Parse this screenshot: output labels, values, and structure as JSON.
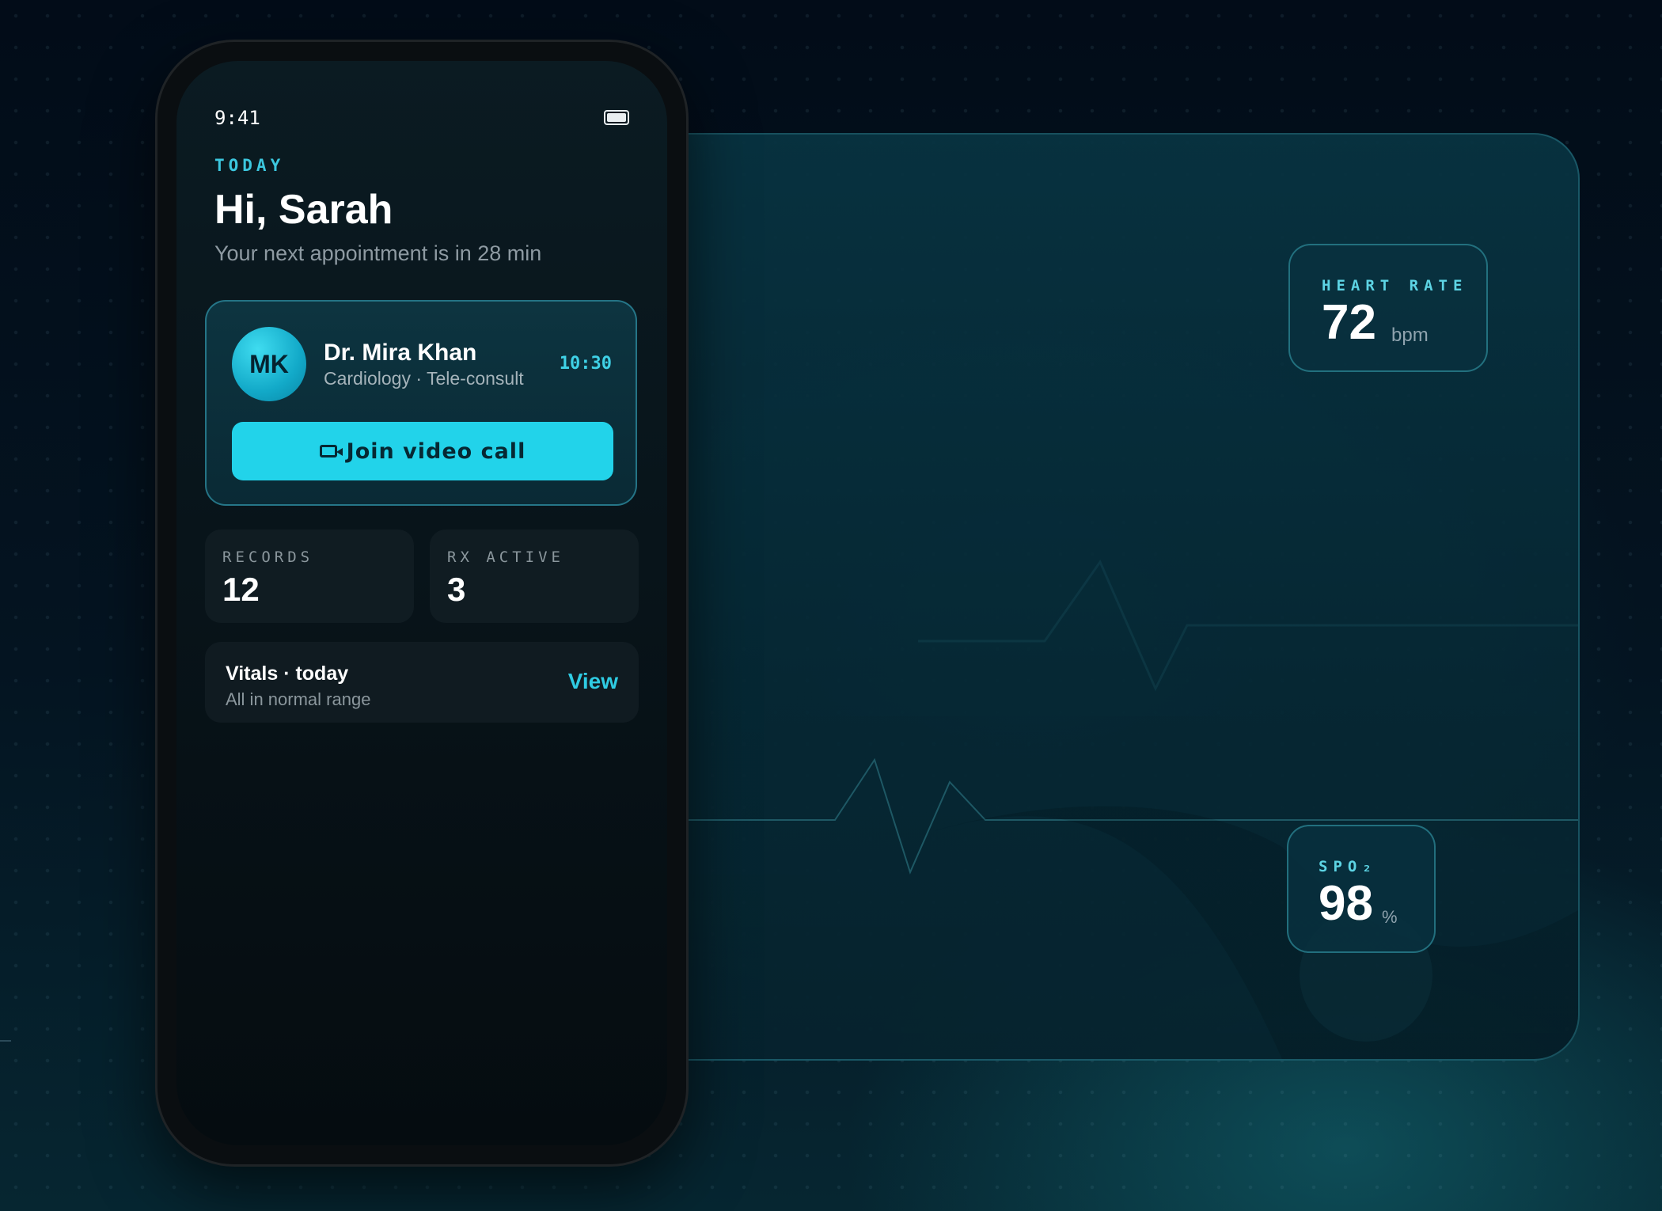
{
  "phone": {
    "status": {
      "time": "9:41",
      "battery_icon": "battery-icon"
    },
    "header": {
      "eyebrow": "TODAY",
      "greeting": "Hi, Sarah",
      "subtitle": "Your next appointment is in 28 min"
    },
    "appointment": {
      "avatar_initials": "MK",
      "doctor_name": "Dr. Mira Khan",
      "specialty": "Cardiology · Tele-consult",
      "time": "10:30",
      "join_label": "Join video call",
      "join_icon": "video-camera-icon"
    },
    "stats": [
      {
        "label": "RECORDS",
        "value": "12"
      },
      {
        "label": "RX ACTIVE",
        "value": "3"
      }
    ],
    "vitals": {
      "title": "Vitals · today",
      "subtitle": "All in normal range",
      "action_label": "View"
    }
  },
  "dashboard": {
    "heart_rate": {
      "label": "HEART RATE",
      "value": "72",
      "unit": "bpm"
    },
    "spo2": {
      "label": "SPO₂",
      "value": "98",
      "unit": "%"
    }
  },
  "colors": {
    "accent": "#22d3ea",
    "accent_text": "#3cc7de",
    "background": "#041421"
  }
}
